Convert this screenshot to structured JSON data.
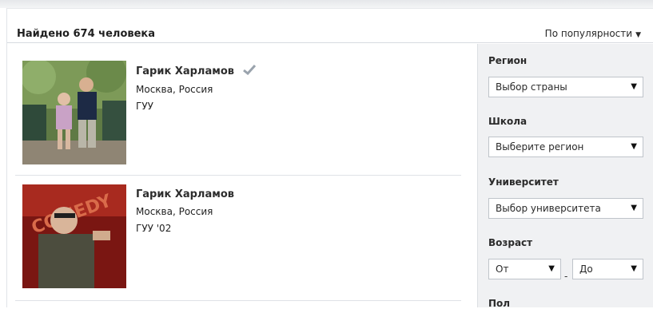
{
  "header": {
    "found_text": "Найдено 674 человека",
    "sort_label": "По популярности",
    "sort_caret": "▼"
  },
  "results": [
    {
      "name": "Гарик Харламов",
      "verified": true,
      "city": "Москва, Россия",
      "education": "ГУУ"
    },
    {
      "name": "Гарик Харламов",
      "verified": false,
      "city": "Москва, Россия",
      "education": "ГУУ '02"
    }
  ],
  "filters": {
    "region": {
      "label": "Регион",
      "value": "Выбор страны"
    },
    "school": {
      "label": "Школа",
      "value": "Выберите регион"
    },
    "university": {
      "label": "Университет",
      "value": "Выбор университета"
    },
    "age": {
      "label": "Возраст",
      "from": "От",
      "to": "До",
      "separator": "-"
    },
    "gender": {
      "label": "Пол"
    }
  },
  "colors": {
    "sidebar_bg": "#f0f1f3",
    "divider": "#dfe2e6",
    "verified_check": "#9aa3ad"
  },
  "icons": {
    "dropdown": "triangle-down-icon",
    "verified": "checkmark-icon"
  }
}
